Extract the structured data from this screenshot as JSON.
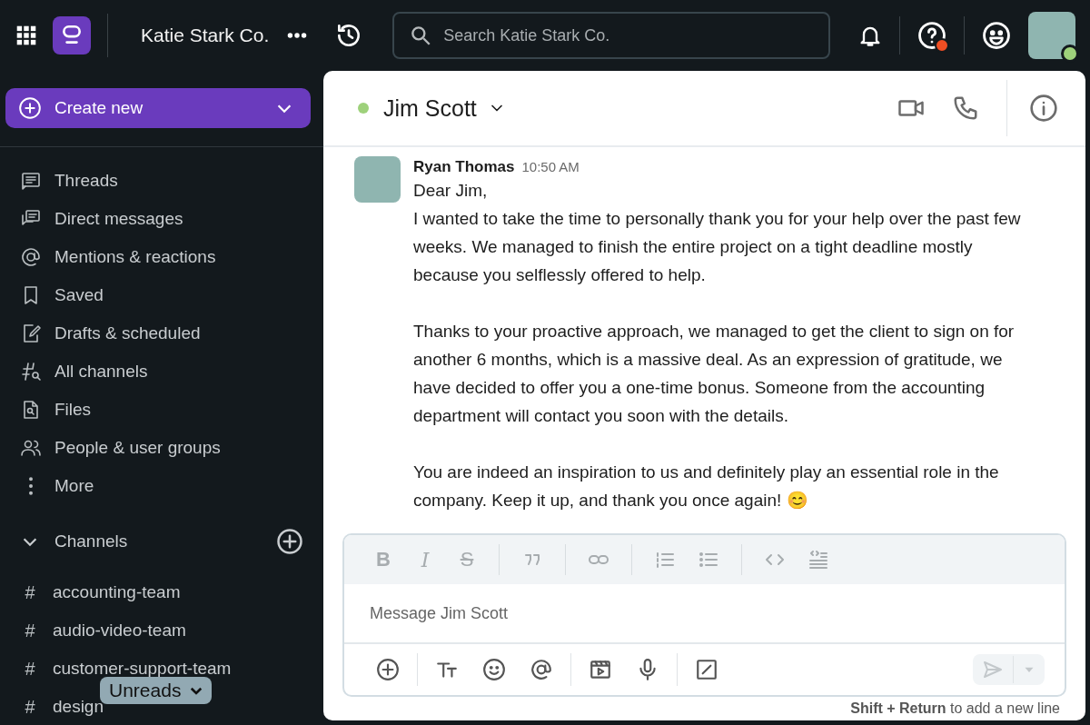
{
  "top_bar": {
    "workspace": "Katie Stark Co.",
    "search": {
      "placeholder": "Search Katie Stark Co."
    },
    "help_badge": true,
    "presence_online": true
  },
  "sidebar": {
    "create_button": "Create new",
    "nav_items": [
      {
        "label": "Threads"
      },
      {
        "label": "Direct messages"
      },
      {
        "label": "Mentions & reactions"
      },
      {
        "label": "Saved"
      },
      {
        "label": "Drafts & scheduled"
      },
      {
        "label": "All channels"
      },
      {
        "label": "Files"
      },
      {
        "label": "People & user groups"
      },
      {
        "label": "More"
      }
    ],
    "channels_section": {
      "title": "Channels",
      "expanded": true,
      "channels": [
        {
          "prefix": "#",
          "name": "accounting-team"
        },
        {
          "prefix": "#",
          "name": "audio-video-team"
        },
        {
          "prefix": "#",
          "name": "customer-support-team"
        },
        {
          "prefix": "#",
          "name": "design"
        }
      ]
    },
    "unreads_pill": "Unreads"
  },
  "conversation": {
    "title": "Jim Scott",
    "online": true,
    "messages": [
      {
        "author": "Ryan Thomas",
        "time": "10:50 AM",
        "paragraphs": [
          "Dear Jim,\nI wanted to take the time to personally thank you for your help over the past few weeks. We managed to finish the entire project on a tight deadline mostly because you selflessly offered to help.",
          "Thanks to your proactive approach, we managed to get the client to sign on for another 6 months, which is a massive deal. As an expression of gratitude, we have decided to offer you a one-time bonus. Someone from the accounting department will contact you soon with the details.",
          "You are indeed an inspiration to us and definitely play an essential role in the company. Keep it up, and thank you once again! 😊"
        ]
      }
    ],
    "composer": {
      "format_glyphs": [
        "B",
        "I",
        "S"
      ],
      "placeholder": "Message Jim Scott",
      "hint": "**Shift + Return** to add a new line"
    }
  }
}
